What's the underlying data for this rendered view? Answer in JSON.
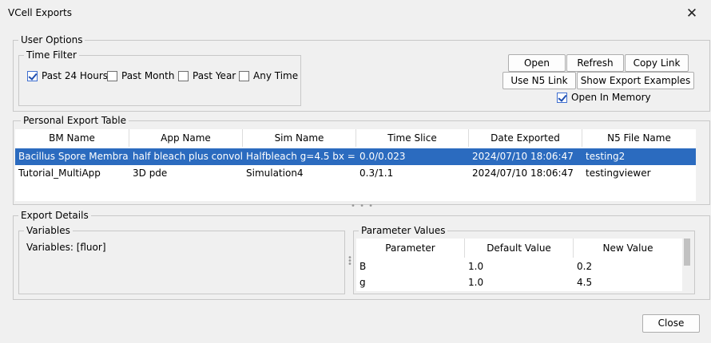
{
  "window": {
    "title": "VCell Exports",
    "close_icon": "✕"
  },
  "user_options": {
    "legend": "User Options",
    "time_filter": {
      "legend": "Time Filter",
      "options": [
        {
          "label": "Past 24 Hours",
          "checked": true
        },
        {
          "label": "Past Month",
          "checked": false
        },
        {
          "label": "Past Year",
          "checked": false
        },
        {
          "label": "Any Time",
          "checked": false
        }
      ]
    },
    "buttons": {
      "open": "Open",
      "refresh": "Refresh",
      "copy_link": "Copy Link",
      "use_n5_link": "Use N5 Link",
      "show_export_examples": "Show Export Examples"
    },
    "open_in_memory": {
      "label": "Open In Memory",
      "checked": true
    }
  },
  "export_table": {
    "legend": "Personal Export Table",
    "columns": [
      "BM Name",
      "App Name",
      "Sim Name",
      "Time Slice",
      "Date Exported",
      "N5 File Name"
    ],
    "rows": [
      [
        "Bacillus Spore Membra...",
        "half bleach plus convol...",
        "Halfbleach  g=4.5 bx = ...",
        "0.0/0.023",
        "2024/07/10 18:06:47",
        "testing2"
      ],
      [
        "Tutorial_MultiApp",
        "3D pde",
        "Simulation4",
        "0.3/1.1",
        "2024/07/10 18:06:47",
        "testingviewer"
      ]
    ],
    "selected_row": 0
  },
  "export_details": {
    "legend": "Export Details",
    "variables": {
      "legend": "Variables",
      "text": "Variables: [fluor]"
    },
    "parameter_values": {
      "legend": "Parameter Values",
      "columns": [
        "Parameter",
        "Default Value",
        "New Value"
      ],
      "rows": [
        [
          "B",
          "1.0",
          "0.2"
        ],
        [
          "g",
          "1.0",
          "4.5"
        ]
      ]
    }
  },
  "footer": {
    "close_label": "Close"
  },
  "colors": {
    "selection": "#2b6bbf",
    "background": "#f0f0f0",
    "accent_check": "#1f4fb0"
  }
}
